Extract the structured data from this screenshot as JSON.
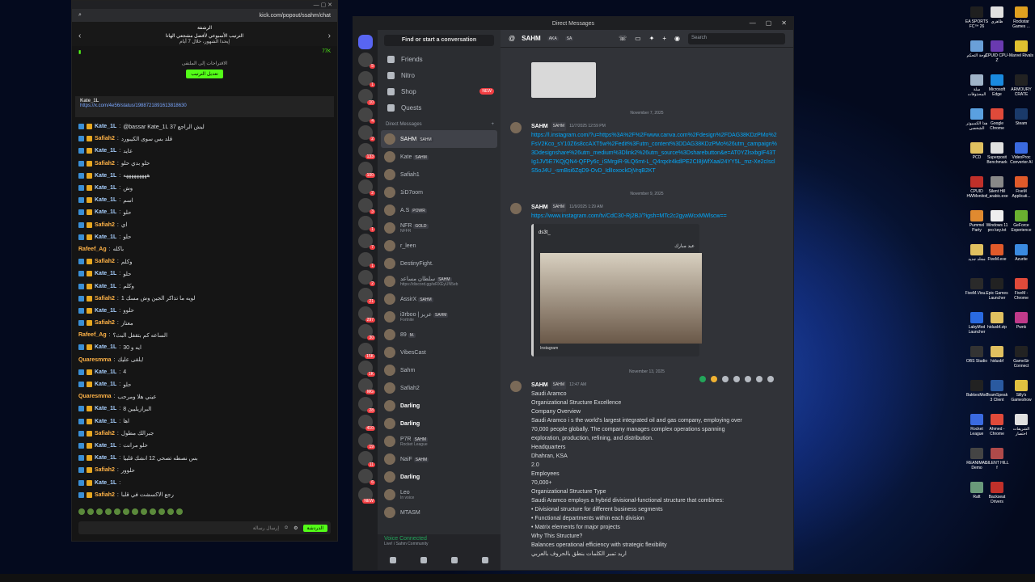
{
  "kick": {
    "url": "kick.com/popout/ssahm/chat",
    "channel_title": "الرشفة",
    "pinned_title": "الترتيب الأسبوعي لأفضل مشجعي الهاتا",
    "pinned_sub": "إيحدا الشهور، خلال 7 أيام",
    "followers": "77K",
    "pinned_note": "الاقتراحات إلى الملتقى",
    "pinned_button": "تعديل الترتيب",
    "pinned_user": "Kate_1L",
    "pinned_link": "https://x.com/4e56/status/1988721891613818630",
    "chat": [
      {
        "user": "Kate_1L",
        "text": "@bassar Kate_1L 37 ليش الراجع"
      },
      {
        "user": "Safiah2",
        "text": "قلد بس سوى الكيبورد"
      },
      {
        "user": "Kate_1L",
        "text": "عايد"
      },
      {
        "user": "Safiah2",
        "text": "حلو بدي حلو"
      },
      {
        "user": "Kate_1L",
        "text": "هههههههههه"
      },
      {
        "user": "Kate_1L",
        "text": "وش"
      },
      {
        "user": "Kate_1L",
        "text": "اسم"
      },
      {
        "user": "Kate_1L",
        "text": "حلو"
      },
      {
        "user": "Safiah2",
        "text": "اي"
      },
      {
        "user": "Kate_1L",
        "text": "حلو"
      },
      {
        "user": "Rafeef_Ag",
        "text": "باكله"
      },
      {
        "user": "Safiah2",
        "text": "وكلم"
      },
      {
        "user": "Kate_1L",
        "text": "حلو"
      },
      {
        "user": "Kate_1L",
        "text": "وكلم"
      },
      {
        "user": "Safiah2",
        "text": "لويه ما تذاكر الجين وش مسك 1"
      },
      {
        "user": "Kate_1L",
        "text": "حلوو"
      },
      {
        "user": "Safiah2",
        "text": "معتاز"
      },
      {
        "user": "Rafeef_Ag",
        "text": "الساعه كم بتقفل البث؟"
      },
      {
        "user": "Kate_1L",
        "text": "ايه و 30"
      },
      {
        "user": "Quaresmma",
        "text": "يلقى عليك!"
      },
      {
        "user": "Kate_1L",
        "text": "4"
      },
      {
        "user": "Kate_1L",
        "text": "حلو"
      },
      {
        "user": "Quaresmma",
        "text": "عيني هلا ومرحب"
      },
      {
        "user": "Kate_1L",
        "text": "البرازيليين 8"
      },
      {
        "user": "Kate_1L",
        "text": "اها"
      },
      {
        "user": "Safiah2",
        "text": "جبرالك مطول"
      },
      {
        "user": "Kate_1L",
        "text": "حلو مرانت"
      },
      {
        "user": "Kate_1L",
        "text": "بس نصطه تصحي 12 انشك قلبيا"
      },
      {
        "user": "Safiah2",
        "text": "حلوور"
      },
      {
        "user": "Kate_1L",
        "text": ""
      },
      {
        "user": "Safiah2",
        "text": "رجع الاكسشت في قلبا"
      }
    ],
    "input_placeholder": "إرسال رسالة",
    "send_label": "الدردشة"
  },
  "discord": {
    "window_title": "Direct Messages",
    "find": "Find or start a conversation",
    "nav": [
      {
        "label": "Friends"
      },
      {
        "label": "Nitro"
      },
      {
        "label": "Shop",
        "badge": "NEW"
      },
      {
        "label": "Quests"
      }
    ],
    "dm_header": "Direct Messages",
    "dms": [
      {
        "name": "SAHM",
        "tag": "SAHM",
        "sub": ""
      },
      {
        "name": "Kate",
        "tag": "SAHM",
        "sub": ""
      },
      {
        "name": "Safiah1",
        "tag": "",
        "sub": ""
      },
      {
        "name": "1iD7oom",
        "tag": "",
        "sub": ""
      },
      {
        "name": "A.S",
        "tag": "POWR",
        "sub": ""
      },
      {
        "name": "NFR",
        "tag": "GOLD",
        "sub": "NFFR"
      },
      {
        "name": "r_leen",
        "tag": "",
        "sub": ""
      },
      {
        "name": "DestinyFight.",
        "tag": "",
        "sub": ""
      },
      {
        "name": "سلطان مساعد",
        "tag": "SAHM",
        "sub": "https://discord.gg/wRXEyUN5eb"
      },
      {
        "name": "AssirX",
        "tag": "SAHM",
        "sub": ""
      },
      {
        "name": "i3rboo | عزيز",
        "tag": "SAHM",
        "sub": "Fortnite"
      },
      {
        "name": "89",
        "tag": "M.",
        "sub": ""
      },
      {
        "name": "VibesCast",
        "tag": "",
        "sub": ""
      },
      {
        "name": "Sahm",
        "tag": "",
        "sub": ""
      },
      {
        "name": "Safiah2",
        "tag": "",
        "sub": ""
      },
      {
        "name": "Darling",
        "tag": "",
        "sub": ""
      },
      {
        "name": "Darling",
        "tag": "",
        "sub": ""
      },
      {
        "name": "P7R",
        "tag": "SAHM",
        "sub": "Rocket League"
      },
      {
        "name": "NaiF",
        "tag": "SAHM",
        "sub": ""
      },
      {
        "name": "Darling",
        "tag": "",
        "sub": ""
      },
      {
        "name": "Leo",
        "tag": "",
        "sub": "In voice"
      },
      {
        "name": "MTASM",
        "tag": "",
        "sub": ""
      }
    ],
    "rail_badges": [
      "5",
      "1",
      "10",
      "4",
      "2",
      "133",
      "100",
      "2",
      "3",
      "1",
      "7",
      "1",
      "2",
      "21",
      "297",
      "30",
      "15K",
      "1K",
      "MG",
      "28",
      "410",
      "19",
      "11",
      "6",
      "NEW"
    ],
    "voice_status": "Voice Connected",
    "voice_sub": "Live! / Sahm Community",
    "top": {
      "name": "SAHM",
      "tags": [
        "AKA",
        "SA"
      ],
      "search": "Search"
    },
    "separators": [
      "November 7, 2025",
      "November 9, 2025",
      "November 13, 2025"
    ],
    "posts": [
      {
        "name": "SAHM",
        "tag": "SAHM",
        "time": "11/7/2025 12:59 PM",
        "link": "https://l.instagram.com/?u=https%3A%2F%2Fwww.canva.com%2Fdesign%2FDAG38KDzPMo%2FsV2Kco_sY10Z6s8ccAXT5w%2Fedit%3Futm_content%3DDAG38KDzPMo%26utm_campaign%3Ddesignshare%26utm_medium%3Dlink2%26utm_source%3Dsharebutton&e=AT0YZlsxbgIF43TIg1JV5E7KQjQN4-QFPy6c_iSMrgiR-9LQ6mt-L_Q4rqxIr4kdlPE2CI8jWfXaal24YY5L_mz-Xe2cIsclS5oJ4U_-smBsi6ZqD9-OvD_IdlIoxockDjVrqB2KT"
      },
      {
        "name": "SAHM",
        "tag": "SAHM",
        "time": "11/9/2025 1:29 AM",
        "link": "https://www.instagram.com/tv/CdC30-Rj2BJ/?igsh=MTc2c2gyaWcxMWlscw==",
        "embed_author": "ds3t_",
        "embed_caption": "عيد مبارك",
        "embed_footer": "Instagram"
      },
      {
        "name": "SAHM",
        "tag": "SAHM",
        "time": "12:47 AM",
        "lines": [
          "Saudi Aramco",
          "Organizational Structure Excellence",
          "Company Overview",
          "Saudi Aramco i s the world's largest integrated oil and gas company, employing over",
          "70,000 people globally. The company manages complex operations spanning",
          "exploration, production, refining, and distribution.",
          "Headquarters",
          "Dhahran, KSA",
          "2.0",
          "Employees",
          "70,000+",
          "Organizational Structure Type",
          "Saudi Aramco employs a hybrid divisional-functional structure that combines:",
          "• Divisional structure for different business segments",
          "• Functional departments within each division",
          "• Matrix elements for major projects",
          "Why This Structure?",
          "Balances operational efficiency with strategic flexibility"
        ]
      }
    ],
    "draft": "اريد تمبر الكلمات بنطق بالحروف بالعربي"
  },
  "desktop_icons": [
    [
      "EA SPORTS FC™ 26",
      "#1f1f1f"
    ],
    [
      "لوحة التحكم",
      "#6aa0d8"
    ],
    [
      "سلة المحذوفات",
      "#9fb3c8"
    ],
    [
      "هذا الكمبيوتر الشخصي",
      "#5aa0e0"
    ],
    [
      "PCD",
      "#e0c060"
    ],
    [
      "CPUID HWMonitor",
      "#c0302a"
    ],
    [
      "Pummel Party",
      "#e08a30"
    ],
    [
      "مجلد جديد",
      "#e0c060"
    ],
    [
      "FiveM.Visu...",
      "#2a2a2a"
    ],
    [
      "LabyMod Launcher",
      "#2a6ae0"
    ],
    [
      "OBS Studio",
      "#333"
    ],
    [
      "BakkesMod",
      "#222"
    ],
    [
      "Rocket League",
      "#3a6ae0"
    ],
    [
      "REANIMAL Demo",
      "#444"
    ],
    [
      "Raft",
      "#6a9a7a"
    ],
    [
      "ظاهري",
      "#e0e0e0"
    ],
    [
      "CPUID CPU-Z",
      "#6a3ab0"
    ],
    [
      "Microsoft Edge",
      "#1a8adf"
    ],
    [
      "Google Chrome",
      "#e04a3a"
    ],
    [
      "Superposit Benchmark",
      "#e0e0e0"
    ],
    [
      "Silent Hill f_arabic.exe",
      "#888"
    ],
    [
      "Windows 11 pro key.txt",
      "#eee"
    ],
    [
      "FiveM.exe",
      "#e05a2a"
    ],
    [
      "Epic Games Launcher",
      "#222"
    ],
    [
      "hidusbf.zip",
      "#e0c060"
    ],
    [
      "hidusbf",
      "#e0c060"
    ],
    [
      "TeamSpeak 3 Client",
      "#2a5aa0"
    ],
    [
      "Ahmed - Chrome",
      "#e04a3a"
    ],
    [
      "SILENT HILL f",
      "#b04a4a"
    ],
    [
      "Backseat Drivers",
      "#c0302a"
    ],
    [
      "Rockstar Games ...",
      "#e0a020"
    ],
    [
      "Marvel Rivals",
      "#e0c030"
    ],
    [
      "ARMOURY CRATE",
      "#222"
    ],
    [
      "Steam",
      "#1a3a6a"
    ],
    [
      "VideoProc Converter AI",
      "#3a6ae0"
    ],
    [
      "FiveM Applicati...",
      "#e05a2a"
    ],
    [
      "GeForce Experience",
      "#6ab030"
    ],
    [
      "Azurite",
      "#3a8ae0"
    ],
    [
      "FiveM - Chrome",
      "#e04a3a"
    ],
    [
      "Pwnk",
      "#c03a8a"
    ],
    [
      "GameSir Connect",
      "#222"
    ],
    [
      "Silly's Gameshow",
      "#e0c040"
    ],
    [
      "الشريفات اختصار",
      "#e0e0e0"
    ]
  ]
}
